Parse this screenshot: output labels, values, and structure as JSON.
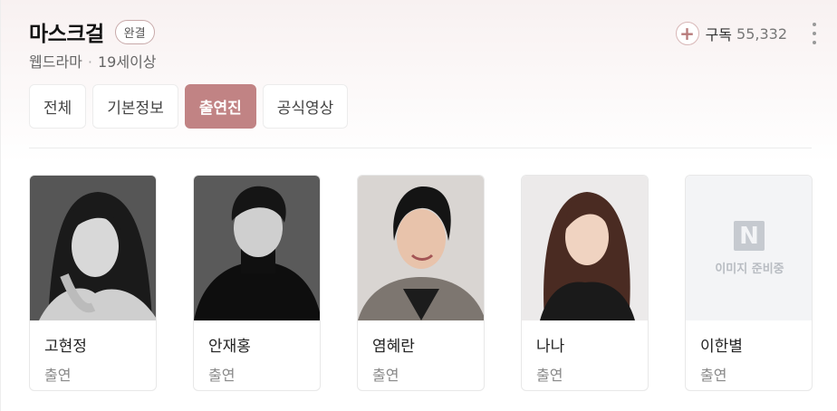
{
  "header": {
    "title": "마스크걸",
    "status_badge": "완결",
    "genre": "웹드라마",
    "separator": "·",
    "rating": "19세이상",
    "subscribe_label": "구독",
    "subscribe_count": "55,332"
  },
  "tabs": [
    {
      "label": "전체",
      "active": false
    },
    {
      "label": "기본정보",
      "active": false
    },
    {
      "label": "출연진",
      "active": true
    },
    {
      "label": "공식영상",
      "active": false
    }
  ],
  "cast": [
    {
      "name": "고현정",
      "role": "출연",
      "photo": "portrait-grayscale"
    },
    {
      "name": "안재홍",
      "role": "출연",
      "photo": "portrait-grayscale"
    },
    {
      "name": "염혜란",
      "role": "출연",
      "photo": "portrait-color"
    },
    {
      "name": "나나",
      "role": "출연",
      "photo": "portrait-color"
    },
    {
      "name": "이한별",
      "role": "출연",
      "photo": "placeholder",
      "placeholder_logo": "N",
      "placeholder_text": "이미지 준비중"
    }
  ],
  "colors": {
    "accent": "#c18384",
    "background_tint": "#f8f1f1"
  }
}
